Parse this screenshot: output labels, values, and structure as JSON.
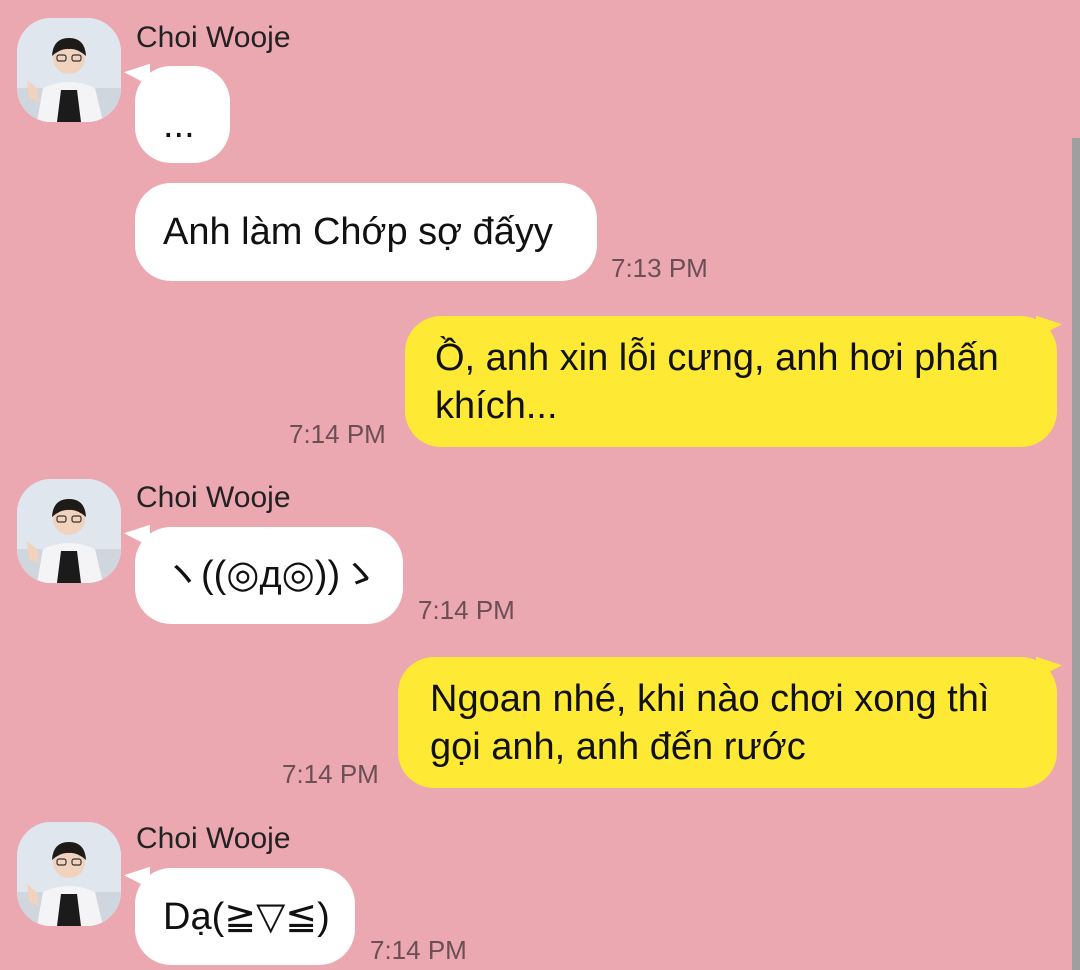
{
  "colors": {
    "background": "#ECA8B1",
    "incoming_bubble": "#FFFFFF",
    "outgoing_bubble": "#FEEA34",
    "timestamp": "#6b4f55"
  },
  "contact": {
    "name": "Choi Wooje",
    "avatar_icon": "profile-photo"
  },
  "messages": [
    {
      "from": "contact",
      "sender": "Choi Wooje",
      "text": "...",
      "time": ""
    },
    {
      "from": "contact",
      "text": "Anh làm Chớp sợ đấyy",
      "time": "7:13 PM"
    },
    {
      "from": "me",
      "text_lines": [
        "Ồ, anh xin lỗi cưng, anh hơi phấn",
        "khích..."
      ],
      "time": "7:14 PM"
    },
    {
      "from": "contact",
      "sender": "Choi Wooje",
      "text": "ヽ((◎д◎))ゝ",
      "time": "7:14 PM"
    },
    {
      "from": "me",
      "text_lines": [
        "Ngoan nhé, khi nào chơi xong thì",
        "gọi anh, anh đến rước"
      ],
      "time": "7:14 PM"
    },
    {
      "from": "contact",
      "sender": "Choi Wooje",
      "text": "Dạ(≧▽≦)",
      "time": "7:14 PM"
    }
  ]
}
